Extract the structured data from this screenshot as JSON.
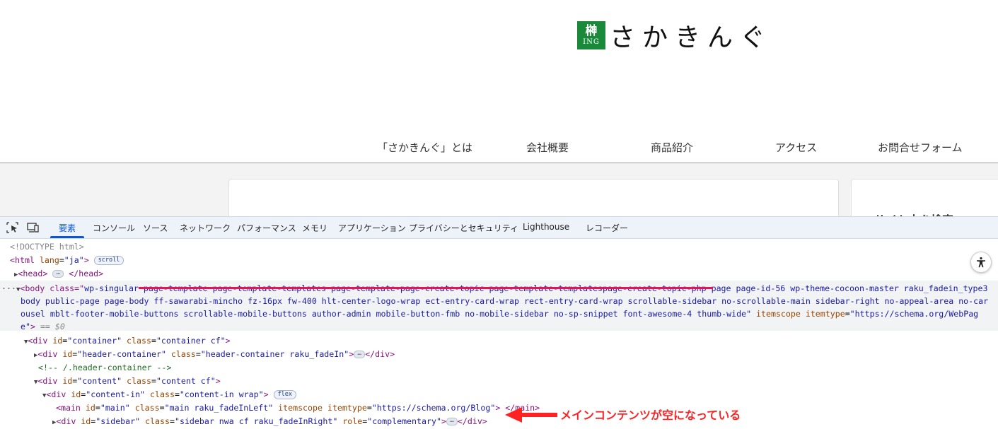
{
  "site": {
    "logo_mark_kanji": "榊",
    "logo_mark_sub": "ING",
    "logo_text": "さかきんぐ",
    "nav": [
      "「さかきんぐ」とは",
      "会社概要",
      "商品紹介",
      "アクセス",
      "お問合せフォーム"
    ],
    "sidebar_title": "サイト内を検索"
  },
  "devtools": {
    "tabs": [
      "要素",
      "コンソール",
      "ソース",
      "ネットワーク",
      "パフォーマンス",
      "メモリ",
      "アプリケーション",
      "プライバシーとセキュリティ",
      "Lighthouse",
      "レコーダー"
    ],
    "active_tab": "要素",
    "dom": {
      "doctype": "<!DOCTYPE html>",
      "html_open": "<html lang=\"ja\">",
      "html_tag": "html",
      "html_attr": "lang",
      "html_val": "\"ja\"",
      "scroll_badge": "scroll",
      "head_line": "head",
      "body_prefix": "<body class=\"",
      "body_class_1": "wp-singular page-template page-template-templates page-template-page-create-topic page-template-templatespage-create-topic-php page page-id-56 wp-theme-cocoon-master raku_fadein_type3",
      "body_class_2": "body public-page page-body ff-sawarabi-mincho fz-16px fw-400 hlt-center-logo-wrap ect-entry-card-wrap rect-entry-card-wrap scrollable-sidebar no-scrollable-main sidebar-right no-appeal-area no-car",
      "body_class_3": "ousel mblt-footer-mobile-buttons scrollable-mobile-buttons author-admin mobile-button-fmb no-mobile-sidebar no-sp-snippet font-awesome-4 thumb-wide\"",
      "body_itemscope": "itemscope",
      "body_itemtype_attr": "itemtype",
      "body_itemtype_val_a": "\"https://schema.org/WebPag",
      "body_itemtype_val_b": "e\"",
      "body_eq": "== $0",
      "container": {
        "id": "\"container\"",
        "class": "\"container cf\""
      },
      "header_container": {
        "id": "\"header-container\"",
        "class": "\"header-container raku_fadeIn\""
      },
      "comment": "<!-- /.header-container -->",
      "content": {
        "id": "\"content\"",
        "class": "\"content cf\""
      },
      "content_in": {
        "id": "\"content-in\"",
        "class": "\"content-in wrap\""
      },
      "flex_badge": "flex",
      "main": {
        "id": "\"main\"",
        "class": "\"main raku_fadeInLeft\"",
        "itemtype": "\"https://schema.org/Blog\""
      },
      "sidebar": {
        "id": "\"sidebar\"",
        "class": "\"sidebar nwa cf raku_fadeInRight\"",
        "role": "\"complementary\""
      }
    }
  },
  "annotation": {
    "text": "メインコンテンツが空になっている",
    "color": "#ff2222"
  },
  "colors": {
    "logo_green": "#1a8a3a",
    "devtools_accent": "#0b57d0",
    "underline_pink": "#e0155a"
  }
}
